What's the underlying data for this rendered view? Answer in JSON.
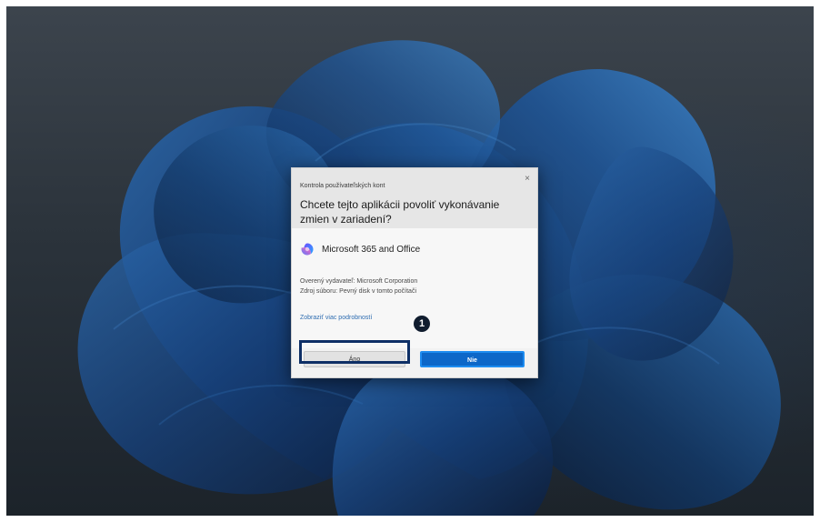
{
  "desktop": {
    "wallpaper_name": "windows-11-bloom",
    "colors": {
      "background_top": "#3c444d",
      "background_bottom": "#1c232a",
      "bloom_dark": "#0f2546",
      "bloom_mid": "#163f78",
      "bloom_light": "#2a66a8"
    }
  },
  "uac_dialog": {
    "caption": "Kontrola používateľských kont",
    "question": "Chcete tejto aplikácii povoliť vykonávanie zmien v zariadení?",
    "app_name": "Microsoft 365 and Office",
    "publisher": "Overený vydavateľ: Microsoft Corporation",
    "source": "Zdroj súboru: Pevný disk v tomto počítači",
    "details_link": "Zobraziť viac podrobností",
    "close_glyph": "×",
    "buttons": {
      "yes": "Áno",
      "no": "Nie"
    },
    "colors": {
      "primary_button": "#0d67c8",
      "link": "#2f6db1"
    },
    "icons": {
      "app": "microsoft-365-icon",
      "close": "close-icon"
    }
  },
  "annotation": {
    "step_number": "1",
    "highlight_color": "#0e2f66"
  }
}
